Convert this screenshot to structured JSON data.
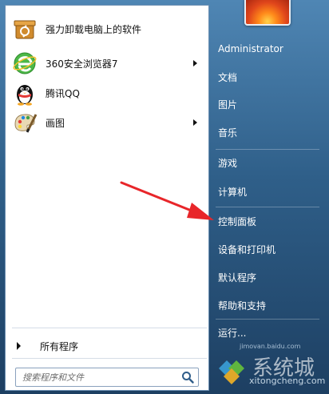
{
  "pinned": [
    {
      "label": "强力卸载电脑上的软件",
      "icon": "uninstaller-box-icon",
      "arrow": false
    },
    {
      "label": "360安全浏览器7",
      "icon": "360-browser-icon",
      "arrow": true
    },
    {
      "label": "腾讯QQ",
      "icon": "qq-penguin-icon",
      "arrow": false
    },
    {
      "label": "画图",
      "icon": "paint-palette-icon",
      "arrow": true
    }
  ],
  "all_programs_label": "所有程序",
  "search": {
    "placeholder": "搜索程序和文件"
  },
  "right_menu": {
    "user": "Administrator",
    "items": [
      "文档",
      "图片",
      "音乐",
      "游戏",
      "计算机",
      "控制面板",
      "设备和打印机",
      "默认程序",
      "帮助和支持",
      "运行..."
    ]
  },
  "watermark": {
    "url": "jimovan.baidu.com",
    "brand": "xitongcheng.com"
  },
  "colors": {
    "arrow": "#e8262a",
    "panel_right": "#2f5f89",
    "accent": "#3aa0d8"
  }
}
